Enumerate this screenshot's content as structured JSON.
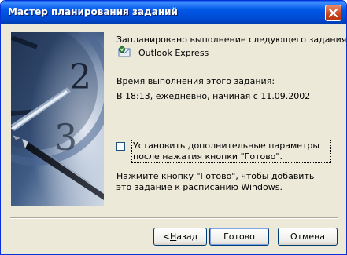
{
  "window": {
    "title": "Мастер планирования заданий"
  },
  "content": {
    "scheduled_label": "Запланировано выполнение следующего задания:",
    "task_name": "Outlook Express",
    "time_label": "Время выполнения этого задания:",
    "time_value": "В 18:13, ежедневно, начиная с 11.09.2002",
    "advanced_checkbox": {
      "checked": false,
      "label": "Установить дополнительные параметры после нажатия кнопки \"Готово\"."
    },
    "hint": "Нажмите кнопку \"Готово\", чтобы добавить это задание к расписанию Windows."
  },
  "buttons": {
    "back_arrow": "< ",
    "back_mnemonic": "Н",
    "back_rest": "азад",
    "finish": "Готово",
    "cancel": "Отмена"
  },
  "icons": [
    "close-icon",
    "task-app-icon",
    "clock-pen-illustration"
  ]
}
